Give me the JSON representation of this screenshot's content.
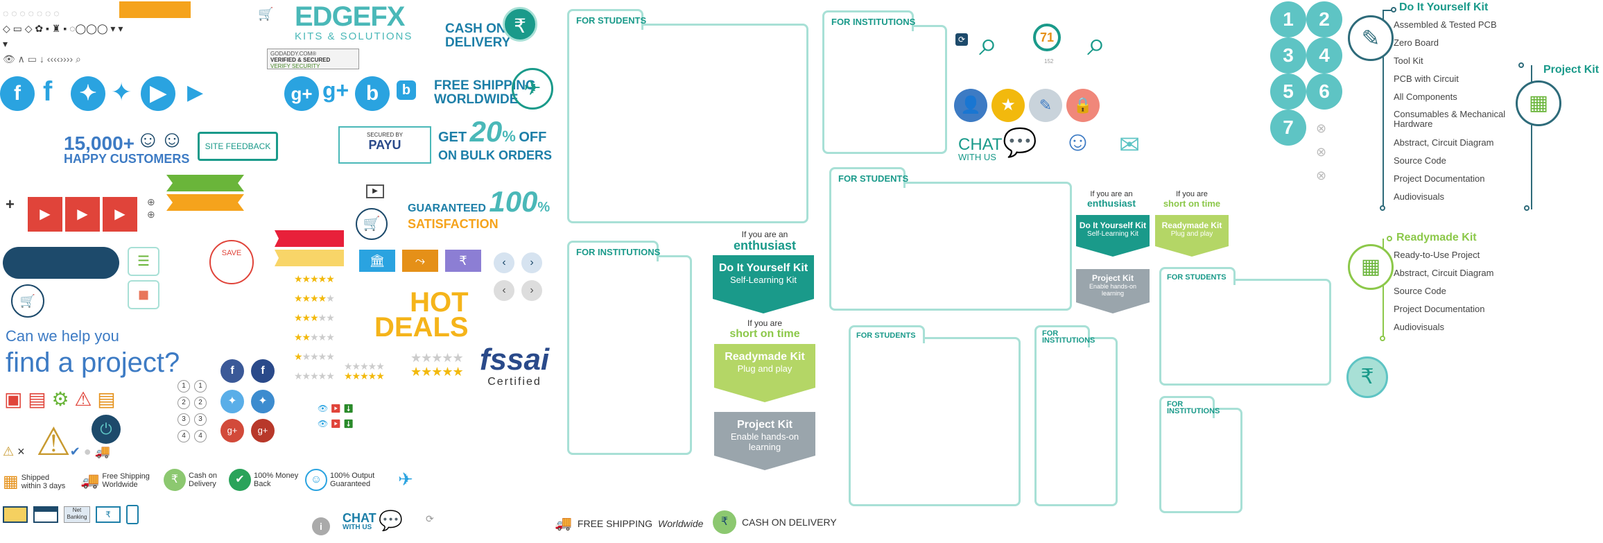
{
  "logo": {
    "name": "EDGEFX",
    "tagline": "KITS & SOLUTIONS"
  },
  "badges": {
    "godaddy_line1": "GODADDY.COM®",
    "godaddy_line2": "VERIFIED & SECURED",
    "godaddy_line3": "VERIFY SECURITY",
    "payu_secured": "SECURED BY",
    "payu": "PAYU",
    "fssai": "fssai",
    "fssai_certified": "Certified"
  },
  "promos": {
    "cod_line1": "CASH ON",
    "cod_line2": "DELIVERY",
    "rupee": "₹",
    "free_ship_line1": "FREE SHIPPING",
    "free_ship_line2": "WORLDWIDE",
    "discount_pre": "GET",
    "discount_pct": "20",
    "discount_suffix": "%",
    "discount_off": "OFF",
    "discount_line2": "ON BULK ORDERS",
    "guaranteed": "GUARANTEED",
    "guaranteed_pct": "100",
    "guaranteed_pct_sign": "%",
    "satisfaction": "SATISFACTION",
    "customers_count": "15,000+",
    "customers_label": "HAPPY CUSTOMERS",
    "site_feedback": "SITE FEEDBACK",
    "hot": "HOT",
    "deals": "DEALS",
    "save": "SAVE",
    "help_line1": "Can we help you",
    "help_line2": "find a project?"
  },
  "features": [
    {
      "line1": "Shipped",
      "line2": "within 3 days"
    },
    {
      "line1": "Free Shipping",
      "line2": "Worldwide"
    },
    {
      "line1": "Cash on",
      "line2": "Delivery"
    },
    {
      "line1": "100% Money",
      "line2": "Back"
    },
    {
      "line1": "100% Output",
      "line2": "Guaranteed"
    }
  ],
  "payments": {
    "netbanking": "Net Banking"
  },
  "chat": {
    "chat": "CHAT",
    "with_us": "WITH US"
  },
  "bottom_bar": {
    "free_shipping": "FREE SHIPPING",
    "worldwide": "Worldwide",
    "cod": "CASH ON DELIVERY"
  },
  "folders": {
    "students": "FOR STUDENTS",
    "institutions": "FOR INSTITUTIONS",
    "institutions_l1": "FOR",
    "institutions_l2": "INSTITUTIONS"
  },
  "audience": {
    "enthusiast_pre": "If you are an",
    "enthusiast": "enthusiast",
    "short_pre": "If you are",
    "short": "short on time"
  },
  "kits": {
    "diy_title": "Do It Yourself Kit",
    "diy_sub": "Self-Learning Kit",
    "diy_sub_large": "Self-Learning Kit",
    "ready_title": "Readymade Kit",
    "ready_sub": "Plug and play",
    "project_title": "Project Kit",
    "project_sub": "Enable hands-on learning"
  },
  "search_count": {
    "value": "71",
    "sub": "152"
  },
  "numbers": [
    "1",
    "2",
    "3",
    "4",
    "5",
    "6",
    "7"
  ],
  "small_numbers": [
    "1",
    "2",
    "3",
    "4"
  ],
  "diy_panel": {
    "title": "Do It Yourself Kit",
    "items": [
      "Assembled & Tested PCB",
      "Zero Board",
      "Tool Kit",
      "PCB with Circuit",
      "All Components",
      "Consumables & Mechanical Hardware",
      "Abstract, Circuit Diagram",
      "Source Code",
      "Project Documentation",
      "Audiovisuals"
    ]
  },
  "project_panel": {
    "title": "Project Kit"
  },
  "ready_panel": {
    "title": "Readymade Kit",
    "items": [
      "Ready-to-Use Project",
      "Abstract, Circuit Diagram",
      "Source Code",
      "Project Documentation",
      "Audiovisuals"
    ]
  },
  "colors": {
    "teal": "#1a9a8a",
    "brand_blue": "#3d7bc4",
    "orange": "#f5a31c",
    "red": "#e0443a",
    "navy": "#1d4a6b"
  }
}
